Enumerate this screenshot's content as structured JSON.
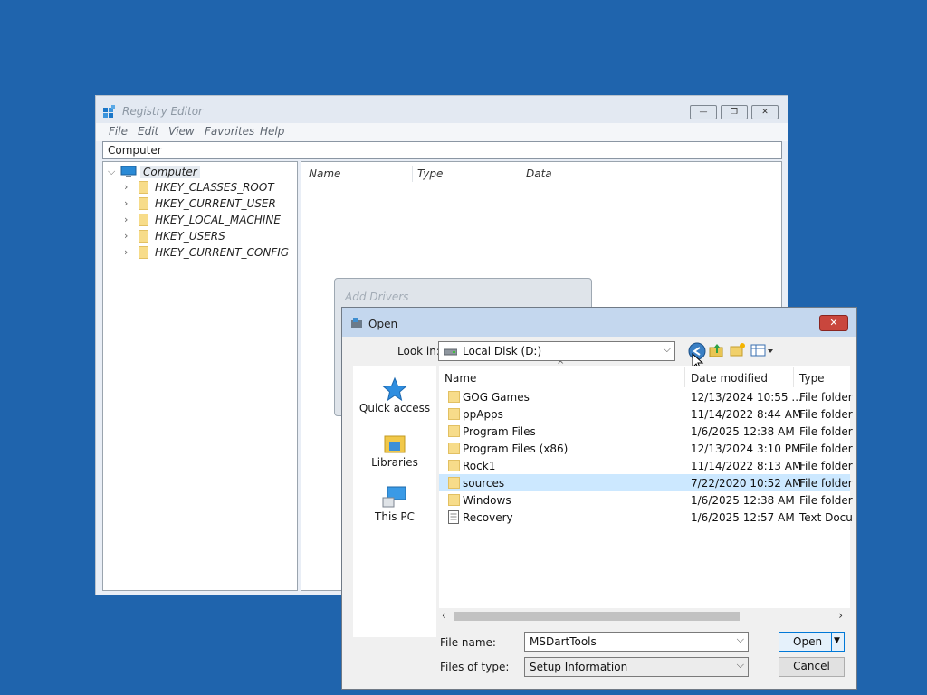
{
  "registry_editor": {
    "title": "Registry Editor",
    "controls": {
      "minimize": "—",
      "restore": "❐",
      "close": "✕"
    },
    "menu": [
      "File",
      "Edit",
      "View",
      "Favorites",
      "Help"
    ],
    "address": "Computer",
    "tree": {
      "root": "Computer",
      "items": [
        "HKEY_CLASSES_ROOT",
        "HKEY_CURRENT_USER",
        "HKEY_LOCAL_MACHINE",
        "HKEY_USERS",
        "HKEY_CURRENT_CONFIG"
      ]
    },
    "columns": [
      "Name",
      "Type",
      "Data"
    ]
  },
  "add_drivers": {
    "title": "Add Drivers"
  },
  "open_dialog": {
    "title": "Open",
    "close": "✕",
    "look_in_label": "Look in:",
    "look_in_value": "Local Disk (D:)",
    "places": [
      "Quick access",
      "Libraries",
      "This PC"
    ],
    "columns": [
      "Name",
      "Date modified",
      "Type"
    ],
    "files": [
      {
        "name": "GOG Games",
        "date": "12/13/2024 10:55 ...",
        "type": "File folder",
        "kind": "folder"
      },
      {
        "name": "ppApps",
        "date": "11/14/2022 8:44 AM",
        "type": "File folder",
        "kind": "folder"
      },
      {
        "name": "Program Files",
        "date": "1/6/2025 12:38 AM",
        "type": "File folder",
        "kind": "folder"
      },
      {
        "name": "Program Files (x86)",
        "date": "12/13/2024 3:10 PM",
        "type": "File folder",
        "kind": "folder"
      },
      {
        "name": "Rock1",
        "date": "11/14/2022 8:13 AM",
        "type": "File folder",
        "kind": "folder"
      },
      {
        "name": "sources",
        "date": "7/22/2020 10:52 AM",
        "type": "File folder",
        "kind": "folder",
        "selected": true
      },
      {
        "name": "Windows",
        "date": "1/6/2025 12:38 AM",
        "type": "File folder",
        "kind": "folder"
      },
      {
        "name": "Recovery",
        "date": "1/6/2025 12:57 AM",
        "type": "Text Docu",
        "kind": "file"
      }
    ],
    "file_name_label": "File name:",
    "file_name_value": "MSDartTools",
    "file_type_label": "Files of type:",
    "file_type_value": "Setup Information",
    "open_button": "Open",
    "cancel_button": "Cancel"
  }
}
